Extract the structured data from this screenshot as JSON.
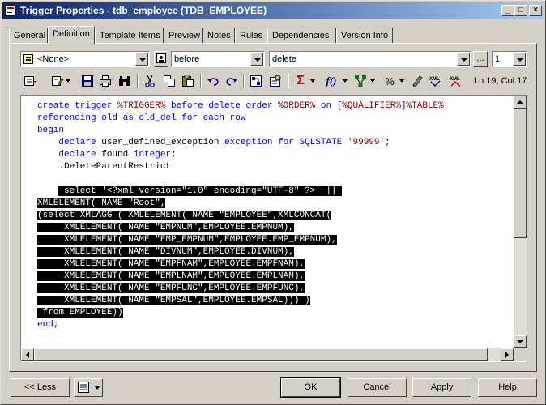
{
  "window": {
    "title": "Trigger Properties - tdb_employee (TDB_EMPLOYEE)",
    "minimize_glyph": "_",
    "maximize_glyph": "□",
    "close_glyph": "×"
  },
  "tabs": [
    {
      "label": "General"
    },
    {
      "label": "Definition",
      "active": true
    },
    {
      "label": "Template Items"
    },
    {
      "label": "Preview"
    },
    {
      "label": "Notes"
    },
    {
      "label": "Rules"
    },
    {
      "label": "Dependencies"
    },
    {
      "label": "Version Info"
    }
  ],
  "definition": {
    "template_combo": "<None>",
    "time_combo": "before",
    "event_combo": "delete",
    "browse_label": "...",
    "order_combo": "1"
  },
  "toolbar": {
    "icons": [
      "properties-icon",
      "edit-icon",
      "open-icon",
      "save-icon",
      "print-icon",
      "find-icon",
      "cut-icon",
      "copy-icon",
      "paste-icon",
      "undo-icon",
      "redo-icon",
      "insert-item-icon",
      "insert-template-icon",
      "sigma-icon",
      "function-icon",
      "tree-icon",
      "percent-icon",
      "edit-with-icon",
      "xml-icon",
      "xml-open-icon"
    ],
    "sigma_glyph": "Σ",
    "function_glyph": "f()",
    "percent_glyph": "%",
    "position": "Ln 19, Col 17"
  },
  "code_lines": [
    [
      {
        "t": "create trigger ",
        "c": "kw"
      },
      {
        "t": "%TRIGGER%",
        "c": "str"
      },
      {
        "t": " before delete order ",
        "c": "kw"
      },
      {
        "t": "%ORDER%",
        "c": "str"
      },
      {
        "t": " on [",
        "c": "kw"
      },
      {
        "t": "%QUALIFIER%",
        "c": "str"
      },
      {
        "t": "]",
        "c": "kw"
      },
      {
        "t": "%TABLE%",
        "c": "str"
      }
    ],
    [
      {
        "t": "referencing old as old_del for each row",
        "c": "kw"
      }
    ],
    [
      {
        "t": "begin",
        "c": "kw"
      }
    ],
    [
      {
        "t": "    ",
        "c": "plain"
      },
      {
        "t": "declare",
        "c": "kw"
      },
      {
        "t": " user_defined_exception ",
        "c": "plain"
      },
      {
        "t": "exception for SQLSTATE",
        "c": "kw"
      },
      {
        "t": " ",
        "c": "plain"
      },
      {
        "t": "'99999'",
        "c": "str"
      },
      {
        "t": ";",
        "c": "plain"
      }
    ],
    [
      {
        "t": "    ",
        "c": "plain"
      },
      {
        "t": "declare",
        "c": "kw"
      },
      {
        "t": " found ",
        "c": "plain"
      },
      {
        "t": "integer",
        "c": "kw"
      },
      {
        "t": ";",
        "c": "plain"
      }
    ],
    [
      {
        "t": "    .DeleteParentRestrict",
        "c": "plain"
      }
    ],
    [
      {
        "t": "",
        "c": "plain"
      }
    ],
    [
      {
        "t": "    ",
        "c": "plain"
      },
      {
        "t": " select '<?xml version=\"1.0\" encoding=\"UTF-8\" ?>' || ",
        "c": "sel"
      }
    ],
    [
      {
        "t": "XMLELEMENT( NAME \"Root\",",
        "c": "sel"
      }
    ],
    [
      {
        "t": "(select XMLAGG ( XMLELEMENT( NAME \"EMPLOYEE\",XMLCONCAT(",
        "c": "sel"
      }
    ],
    [
      {
        "t": "     XMLELEMENT( NAME \"EMPNUM\",EMPLOYEE.EMPNUM),",
        "c": "sel"
      }
    ],
    [
      {
        "t": "     XMLELEMENT( NAME \"EMP_EMPNUM\",EMPLOYEE.EMP_EMPNUM),",
        "c": "sel"
      }
    ],
    [
      {
        "t": "     XMLELEMENT( NAME \"DIVNUM\",EMPLOYEE.DIVNUM),",
        "c": "sel"
      }
    ],
    [
      {
        "t": "     XMLELEMENT( NAME \"EMPFNAM\",EMPLOYEE.EMPFNAM),",
        "c": "sel"
      }
    ],
    [
      {
        "t": "     XMLELEMENT( NAME \"EMPLNAM\",EMPLOYEE.EMPLNAM),",
        "c": "sel"
      }
    ],
    [
      {
        "t": "     XMLELEMENT( NAME \"EMPFUNC\",EMPLOYEE.EMPFUNC),",
        "c": "sel"
      }
    ],
    [
      {
        "t": "     XMLELEMENT( NAME \"EMPSAL\",EMPLOYEE.EMPSAL))) )",
        "c": "sel"
      }
    ],
    [
      {
        "t": " from EMPLOYEE))",
        "c": "sel"
      }
    ],
    [
      {
        "t": "end;",
        "c": "kw"
      }
    ]
  ],
  "buttons": {
    "less": "<< Less",
    "ok": "OK",
    "cancel": "Cancel",
    "apply": "Apply",
    "help": "Help"
  }
}
